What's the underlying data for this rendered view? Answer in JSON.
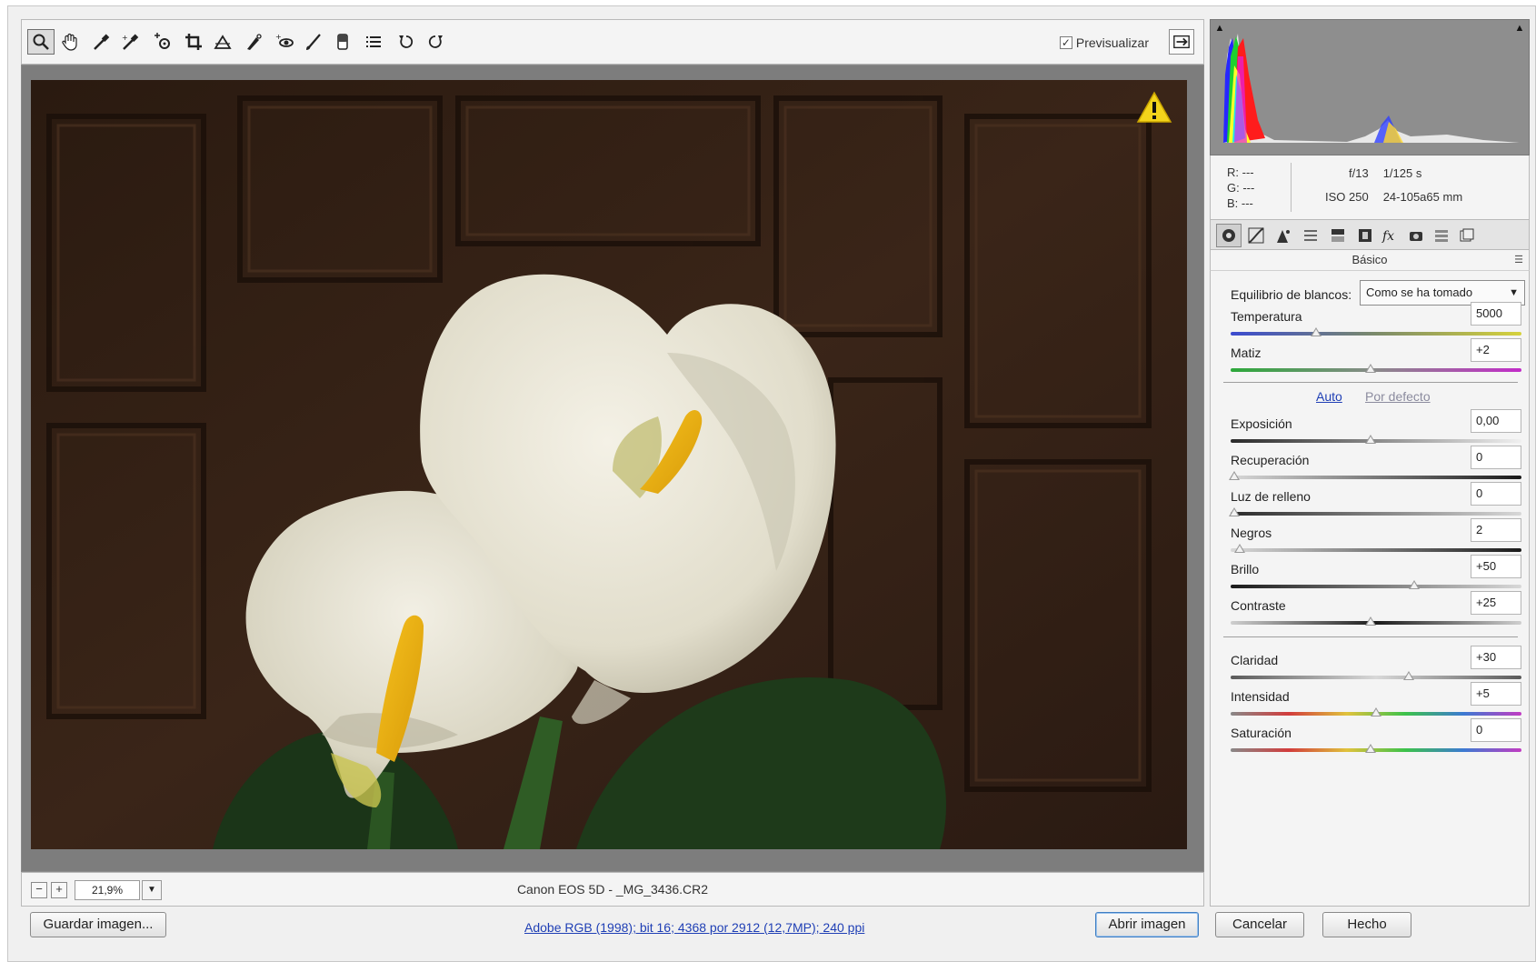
{
  "toolbar": {
    "tools": [
      "zoom-tool-icon",
      "hand-tool-icon",
      "white-balance-tool-icon",
      "color-sampler-tool-icon",
      "targeted-adjustment-tool-icon",
      "crop-tool-icon",
      "straighten-tool-icon",
      "spot-removal-tool-icon",
      "red-eye-removal-tool-icon",
      "adjustment-brush-icon",
      "graduated-filter-icon",
      "preferences-icon",
      "rotate-ccw-icon",
      "rotate-cw-icon"
    ],
    "preview_label": "Previsualizar",
    "preview_checked": "✓"
  },
  "status": {
    "zoom_value": "21,9%",
    "filename": "Canon EOS 5D -  _MG_3436.CR2"
  },
  "exif": {
    "r": "R:  ---",
    "g": "G:  ---",
    "b": "B:  ---",
    "aperture": "f/13",
    "shutter": "1/125 s",
    "iso": "ISO 250",
    "lens": "24-105a65 mm"
  },
  "panel": {
    "title": "Básico",
    "white_balance_label": "Equilibrio de blancos:",
    "white_balance_value": "Como se ha tomado",
    "auto_label": "Auto",
    "default_label": "Por defecto",
    "controls": [
      {
        "label": "Temperatura",
        "value": "5000",
        "pos": 0.3
      },
      {
        "label": "Matiz",
        "value": "+2",
        "pos": 0.5
      },
      {
        "label": "Exposición",
        "value": "0,00",
        "pos": 0.5
      },
      {
        "label": "Recuperación",
        "value": "0",
        "pos": 0.0
      },
      {
        "label": "Luz de relleno",
        "value": "0",
        "pos": 0.0
      },
      {
        "label": "Negros",
        "value": "2",
        "pos": 0.02
      },
      {
        "label": "Brillo",
        "value": "+50",
        "pos": 0.66
      },
      {
        "label": "Contraste",
        "value": "+25",
        "pos": 0.5
      },
      {
        "label": "Claridad",
        "value": "+30",
        "pos": 0.64
      },
      {
        "label": "Intensidad",
        "value": "+5",
        "pos": 0.52
      },
      {
        "label": "Saturación",
        "value": "0",
        "pos": 0.5
      }
    ]
  },
  "footer": {
    "save_label": "Guardar imagen...",
    "workflow_link": "Adobe RGB (1998); bit 16; 4368 por 2912 (12,7MP); 240 ppi",
    "open_label": "Abrir imagen",
    "cancel_label": "Cancelar",
    "done_label": "Hecho"
  }
}
